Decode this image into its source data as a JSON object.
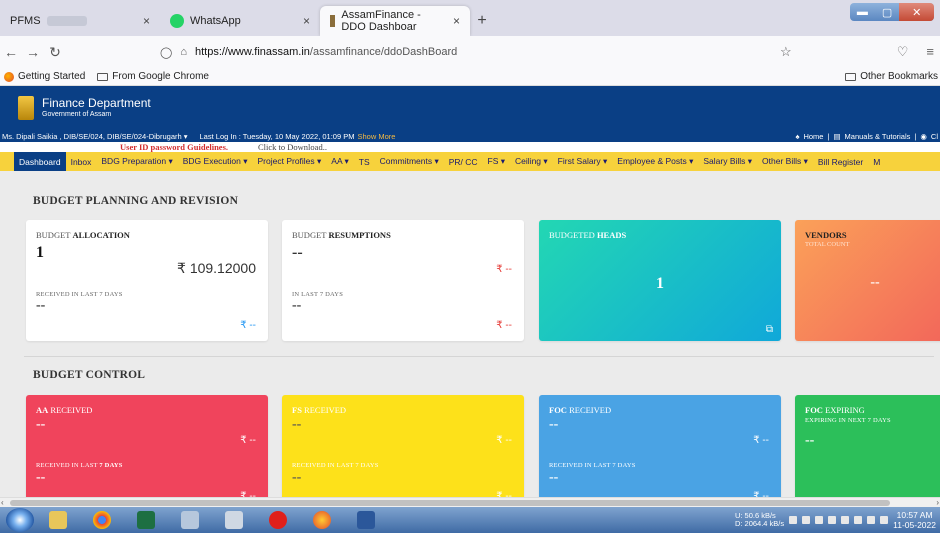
{
  "browser": {
    "tabs": [
      {
        "label": "PFMS",
        "close": "×"
      },
      {
        "label": "WhatsApp",
        "close": "×"
      },
      {
        "label": "AssamFinance - DDO Dashboar",
        "close": "×",
        "active": true
      }
    ],
    "new_tab": "+",
    "url_host": "https://www.finassam.in",
    "url_path": "/assamfinance/ddoDashBoard",
    "bookmarks": [
      "Getting Started",
      "From Google Chrome"
    ],
    "other_bookmarks": "Other Bookmarks"
  },
  "site": {
    "dept_name": "Finance Department",
    "dept_sub": "Government of Assam",
    "user_info": "Ms. Dipali Saikia , DIB/SE/024, DIB/SE/024-Dibrugarh ▾",
    "last_login": "Last Log In : Tuesday, 10 May 2022, 01:09 PM",
    "show_more": "Show More",
    "home_link": "Home",
    "manuals_link": "Manuals & Tutorials",
    "extra_link": "Cl",
    "guideline_red": "User ID password Guidelines.",
    "guideline_dl": "Click to Download.."
  },
  "menu": [
    "Dashboard",
    "Inbox",
    "BDG Preparation ▾",
    "BDG Execution ▾",
    "Project Profiles ▾",
    "AA ▾",
    "TS",
    "Commitments ▾",
    "PR/ CC",
    "FS ▾",
    "Ceiling ▾",
    "First Salary ▾",
    "Employee & Posts ▾",
    "Salary Bills ▾",
    "Other Bills ▾",
    "Bill Register",
    "M"
  ],
  "sections": {
    "planning_title": "BUDGET PLANNING AND REVISION",
    "control_title": "BUDGET CONTROL"
  },
  "cards": {
    "allocation": {
      "pre": "BUDGET ",
      "title": "ALLOCATION",
      "count": "1",
      "amount": "₹ 109.12000",
      "sub": "RECEIVED IN LAST 7 DAYS",
      "sub_val": "--",
      "sub_amt": "₹ --"
    },
    "resumptions": {
      "pre": "BUDGET ",
      "title": "RESUMPTIONS",
      "count": "--",
      "amount": "₹ --",
      "sub": "IN LAST 7 DAYS",
      "sub_val": "--",
      "sub_amt": "₹ --"
    },
    "heads": {
      "pre": "BUDGETED ",
      "title": "HEADS",
      "count": "1",
      "ext": "⧉"
    },
    "vendors": {
      "title": "VENDORS",
      "sub": "TOTAL COUNT",
      "count": "--"
    },
    "aa": {
      "pre": "AA",
      "title": " RECEIVED",
      "count": "--",
      "amount": "₹ --",
      "sub": "RECEIVED IN LAST ",
      "sub_b": "7 DAYS",
      "sub_val": "--",
      "sub_amt": "₹ --"
    },
    "fs": {
      "pre": "FS",
      "title": " RECEIVED",
      "count": "--",
      "amount": "₹ --",
      "sub": "RECEIVED IN LAST 7 DAYS",
      "sub_val": "--",
      "sub_amt": "₹ --"
    },
    "foc": {
      "pre": "FOC",
      "title": " RECEIVED",
      "count": "--",
      "amount": "₹ --",
      "sub": "RECEIVED IN LAST 7 DAYS",
      "sub_val": "--",
      "sub_amt": "₹ --"
    },
    "foc_expiring": {
      "pre": "FOC",
      "title": " EXPIRING",
      "sub": "EXPIRING IN NEXT 7 DAYS",
      "count": "--"
    }
  },
  "taskbar": {
    "net_up": "U:    50.6 kB/s",
    "net_down": "D:  2064.4 kB/s",
    "time": "10:57 AM",
    "date": "11-05-2022"
  },
  "colors": {
    "header_blue": "#0a3f85",
    "menu_yellow": "#f7d23c",
    "card_red": "#f0445c",
    "card_yellow": "#fde11a",
    "card_blue": "#4aa3e4",
    "card_green": "#2cbf5a"
  },
  "icons": {
    "back": "back-arrow-icon",
    "forward": "forward-arrow-icon",
    "reload": "reload-icon",
    "shield": "shield-icon",
    "lock": "lock-icon",
    "star": "bookmark-star-icon",
    "pocket": "pocket-icon",
    "menu": "hamburger-menu-icon"
  }
}
